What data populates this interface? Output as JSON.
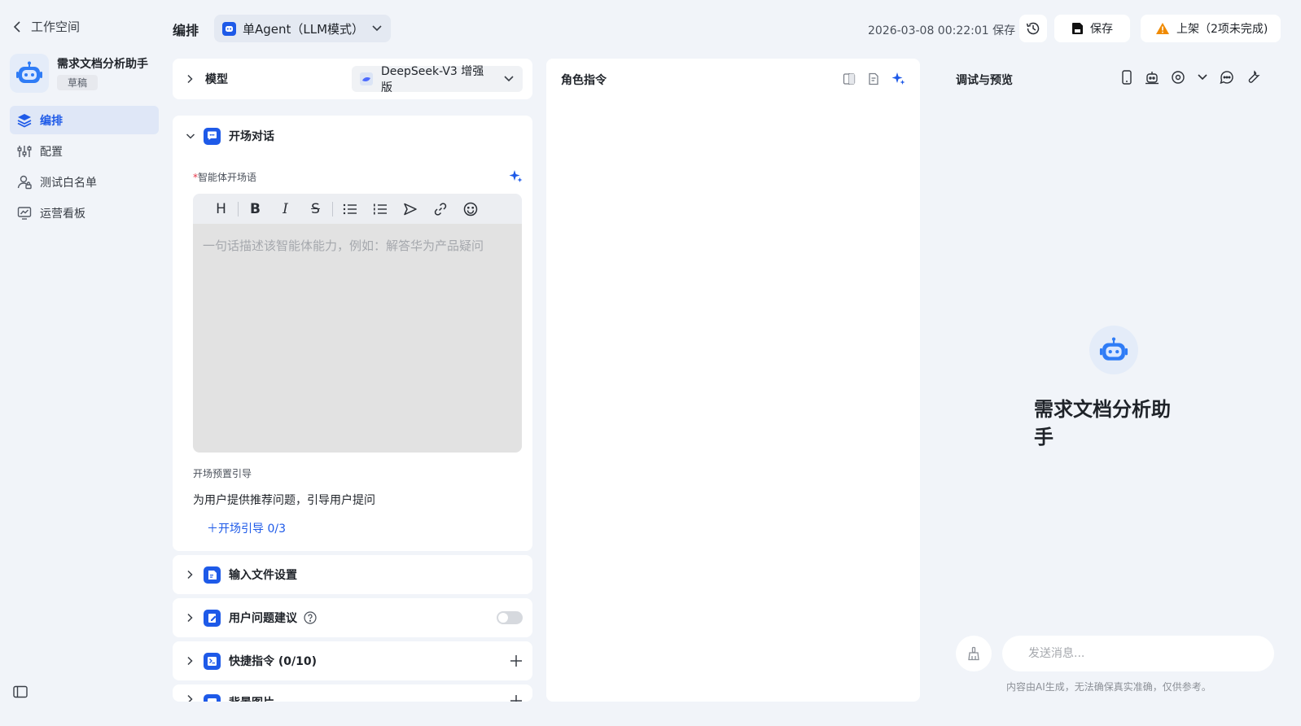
{
  "sidebar": {
    "back_label": "工作空间",
    "agent_name": "需求文档分析助手",
    "agent_status": "草稿",
    "nav": [
      {
        "label": "编排",
        "icon": "layers-icon",
        "active": true
      },
      {
        "label": "配置",
        "icon": "sliders-icon",
        "active": false
      },
      {
        "label": "测试白名单",
        "icon": "user-list-icon",
        "active": false
      },
      {
        "label": "运营看板",
        "icon": "dashboard-icon",
        "active": false
      }
    ]
  },
  "header": {
    "title": "编排",
    "mode": "单Agent（LLM模式）",
    "save_time": "2026-03-08 00:22:01 保存",
    "save_label": "保存",
    "publish_label": "上架（2项未完成)"
  },
  "model": {
    "label": "模型",
    "selected": "DeepSeek-V3 增强版"
  },
  "opening": {
    "title": "开场对话",
    "field_label": "智能体开场语",
    "required_mark": "*",
    "placeholder": "一句话描述该智能体能力，例如：解答华为产品疑问",
    "preset_label": "开场预置引导",
    "preset_desc": "为用户提供推荐问题，引导用户提问",
    "add_guide": "＋开场引导 0/3",
    "toolbar": [
      "H",
      "B",
      "I",
      "S"
    ]
  },
  "sections": [
    {
      "label": "输入文件设置",
      "right": "none"
    },
    {
      "label": "用户问题建议",
      "right": "toggle"
    },
    {
      "label": "快捷指令 (0/10)",
      "right": "plus"
    },
    {
      "label": "背景图片",
      "right": "plus"
    }
  ],
  "role": {
    "title": "角色指令"
  },
  "preview": {
    "title": "调试与预览",
    "agent_name": "需求文档分析助手",
    "input_placeholder": "发送消息...",
    "disclaimer": "内容由AI生成，无法确保真实准确，仅供参考。"
  },
  "colors": {
    "accent": "#1e5ae8",
    "warning": "#f08a00",
    "background": "#f1f4f9"
  }
}
